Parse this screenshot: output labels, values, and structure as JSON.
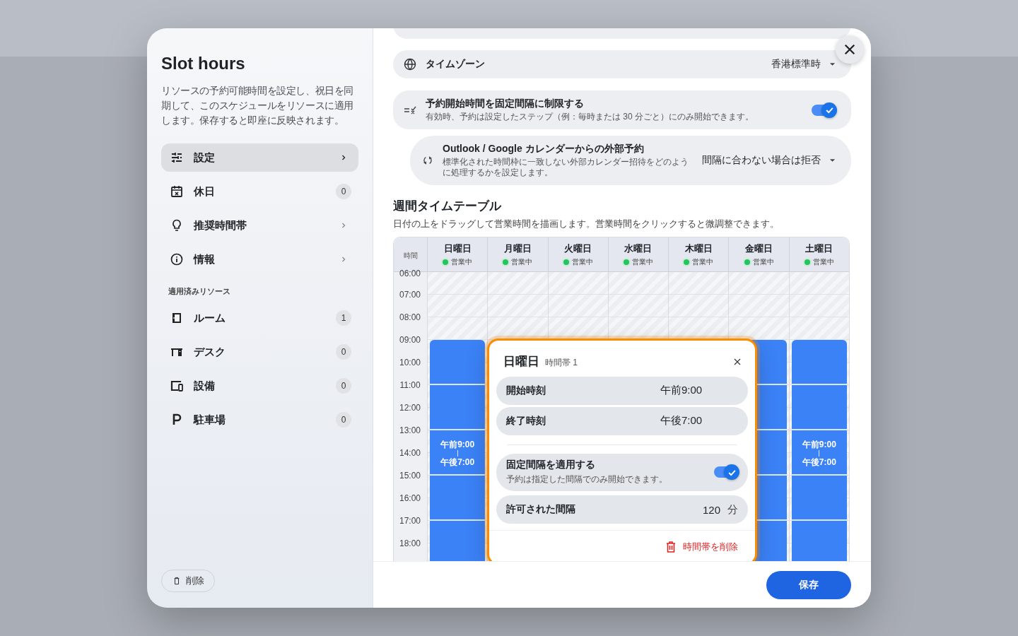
{
  "sidebar": {
    "title": "Slot hours",
    "description": "リソースの予約可能時間を設定し、祝日を同期して、このスケジュールをリソースに適用します。保存すると即座に反映されます。",
    "nav": [
      {
        "label": "設定",
        "selected": true
      },
      {
        "label": "休日",
        "selected": false,
        "badge": "0"
      },
      {
        "label": "推奨時間帯",
        "selected": false
      },
      {
        "label": "情報",
        "selected": false
      }
    ],
    "section_label": "適用済みリソース",
    "resources": [
      {
        "label": "ルーム",
        "count": "1"
      },
      {
        "label": "デスク",
        "count": "0"
      },
      {
        "label": "設備",
        "count": "0"
      },
      {
        "label": "駐車場",
        "count": "0"
      }
    ],
    "delete_button": "削除"
  },
  "settings": {
    "timezone": {
      "label": "タイムゾーン",
      "value": "香港標準時"
    },
    "restrict": {
      "title": "予約開始時間を固定間隔に制限する",
      "description": "有効時、予約は設定したステップ（例：毎時または 30 分ごと）にのみ開始できます。",
      "on": true
    },
    "external": {
      "title": "Outlook / Google カレンダーからの外部予約",
      "description": "標準化された時間枠に一致しない外部カレンダー招待をどのように処理するかを設定します。",
      "value": "間隔に合わない場合は拒否"
    }
  },
  "timetable": {
    "title": "週間タイムテーブル",
    "description": "日付の上をドラッグして営業時間を描画します。営業時間をクリックすると微調整できます。",
    "time_header": "時間",
    "times": [
      "06:00",
      "07:00",
      "08:00",
      "09:00",
      "10:00",
      "11:00",
      "12:00",
      "13:00",
      "14:00",
      "15:00",
      "16:00",
      "17:00",
      "18:00"
    ],
    "days": [
      {
        "name": "日曜日",
        "status": "営業中",
        "color": "#22c55e",
        "block_start": "午前9:00",
        "block_end": "午後7:00"
      },
      {
        "name": "月曜日",
        "status": "営業中",
        "color": "#22c55e"
      },
      {
        "name": "火曜日",
        "status": "営業中",
        "color": "#22c55e"
      },
      {
        "name": "水曜日",
        "status": "営業中",
        "color": "#22c55e"
      },
      {
        "name": "木曜日",
        "status": "営業中",
        "color": "#22c55e"
      },
      {
        "name": "金曜日",
        "status": "営業中",
        "color": "#22c55e"
      },
      {
        "name": "土曜日",
        "status": "営業中",
        "color": "#22c55e",
        "block_start": "午前9:00",
        "block_end": "午後7:00"
      }
    ]
  },
  "popover": {
    "day": "日曜日",
    "slot": "時間帯 1",
    "rows": [
      {
        "label": "開始時刻",
        "value": "午前9:00"
      },
      {
        "label": "終了時刻",
        "value": "午後7:00"
      }
    ],
    "fixed": {
      "title": "固定間隔を適用する",
      "description": "予約は指定した間隔でのみ開始できます。",
      "on": true
    },
    "interval": {
      "label": "許可された間隔",
      "value": "120",
      "unit": "分"
    },
    "delete_label": "時間帯を削除"
  },
  "footer": {
    "save": "保存"
  }
}
